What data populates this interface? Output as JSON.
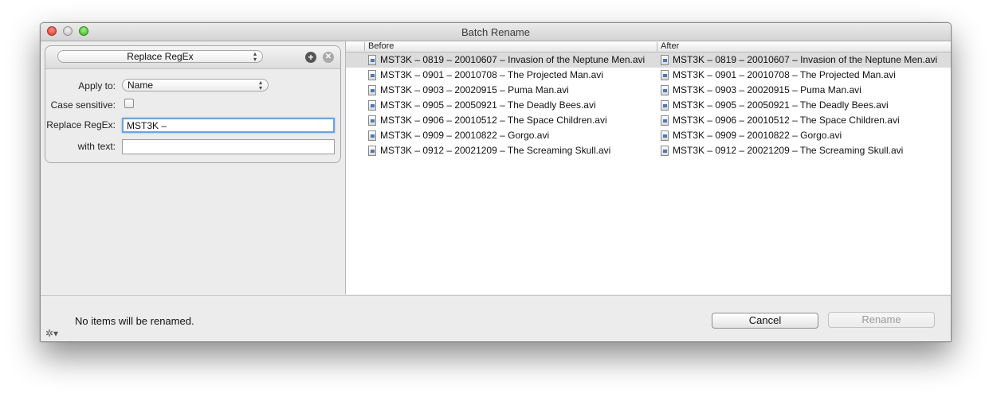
{
  "window": {
    "title": "Batch Rename"
  },
  "rule": {
    "type_label": "Replace RegEx",
    "apply_to_label": "Apply to:",
    "apply_to_value": "Name",
    "case_sensitive_label": "Case sensitive:",
    "case_sensitive_checked": false,
    "regex_label": "Replace RegEx:",
    "regex_value": "MST3K –",
    "with_label": "with text:",
    "with_value": ""
  },
  "table": {
    "columns": {
      "before": "Before",
      "after": "After"
    },
    "rows": [
      {
        "before": "MST3K – 0819 – 20010607 – Invasion of the Neptune Men.avi",
        "after": "MST3K – 0819 – 20010607 – Invasion of the Neptune Men.avi"
      },
      {
        "before": "MST3K – 0901 – 20010708 – The Projected Man.avi",
        "after": "MST3K – 0901 – 20010708 – The Projected Man.avi"
      },
      {
        "before": "MST3K – 0903 – 20020915 – Puma Man.avi",
        "after": "MST3K – 0903 – 20020915 – Puma Man.avi"
      },
      {
        "before": "MST3K – 0905 – 20050921 – The Deadly Bees.avi",
        "after": "MST3K – 0905 – 20050921 – The Deadly Bees.avi"
      },
      {
        "before": "MST3K – 0906 – 20010512 – The Space Children.avi",
        "after": "MST3K – 0906 – 20010512 – The Space Children.avi"
      },
      {
        "before": "MST3K – 0909 – 20010822 – Gorgo.avi",
        "after": "MST3K – 0909 – 20010822 – Gorgo.avi"
      },
      {
        "before": "MST3K – 0912 – 20021209 – The Screaming Skull.avi",
        "after": "MST3K – 0912 – 20021209 – The Screaming Skull.avi"
      }
    ]
  },
  "footer": {
    "status": "No items will be renamed.",
    "cancel_label": "Cancel",
    "rename_label": "Rename"
  },
  "icons": {
    "add": "add-icon",
    "remove": "remove-icon",
    "gear": "gear-icon",
    "file": "video-file-icon"
  }
}
